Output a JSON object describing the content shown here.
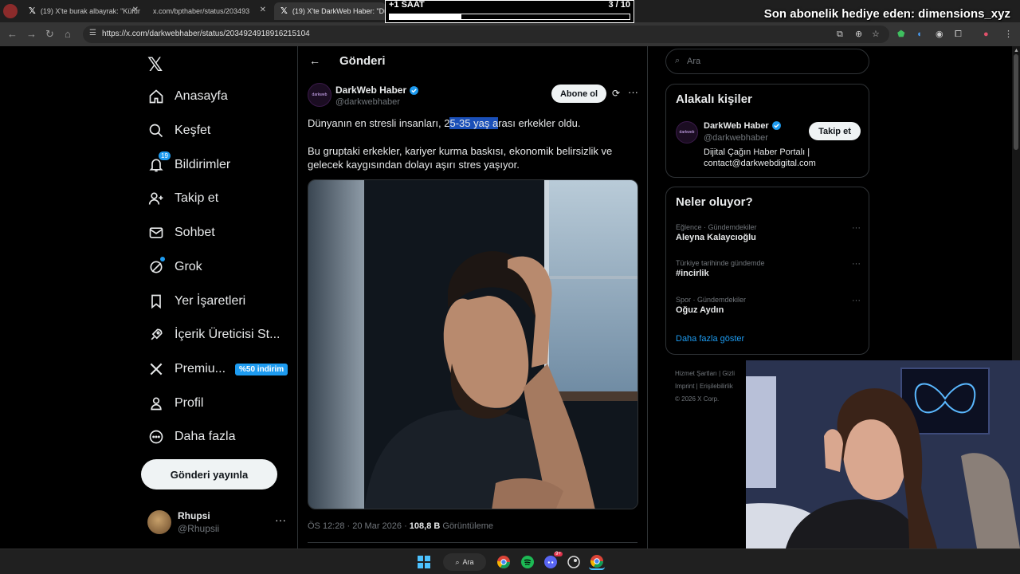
{
  "browser": {
    "tabs": [
      {
        "title": "(19) X'te burak albayrak: \"Küfür",
        "active": false
      },
      {
        "title": "x.com/bpthaber/status/203493",
        "active": false
      },
      {
        "title": "(19) X'te DarkWeb Haber: \"Dün",
        "active": true
      }
    ],
    "url": "https://x.com/darkwebhaber/status/2034924918916215104"
  },
  "overlay": {
    "timer_label": "+1 SAAT",
    "count": "3  / 10",
    "progress": 0.3,
    "sub_gift": "Son abonelik hediye eden: dimensions_xyz"
  },
  "nav": {
    "items": [
      {
        "label": "Anasayfa",
        "icon": "home-icon"
      },
      {
        "label": "Keşfet",
        "icon": "search-icon"
      },
      {
        "label": "Bildirimler",
        "icon": "bell-icon",
        "badge": "19"
      },
      {
        "label": "Takip et",
        "icon": "follow-icon"
      },
      {
        "label": "Sohbet",
        "icon": "mail-icon"
      },
      {
        "label": "Grok",
        "icon": "grok-icon"
      },
      {
        "label": "Yer İşaretleri",
        "icon": "bookmark-icon"
      },
      {
        "label": "İçerik Üreticisi St...",
        "icon": "rocket-icon"
      },
      {
        "label": "Premiu...",
        "icon": "x-premium-icon",
        "tag": "%50 indirim"
      },
      {
        "label": "Profil",
        "icon": "profile-icon"
      },
      {
        "label": "Daha fazla",
        "icon": "more-circle-icon"
      }
    ],
    "post_button": "Gönderi yayınla",
    "account": {
      "name": "Rhupsi",
      "handle": "@Rhupsii"
    }
  },
  "post": {
    "header_title": "Gönderi",
    "author_name": "DarkWeb Haber",
    "author_handle": "@darkwebhaber",
    "avatar_text": "darkweb",
    "subscribe_label": "Abone ol",
    "text1_before": "Dünyanın en stresli insanları, 2",
    "text1_highlight": "5-35 yaş a",
    "text1_after": "rası erkekler oldu.",
    "text2": "Bu gruptaki erkekler, kariyer kurma baskısı, ekonomik belirsizlik ve gelecek kaygısından dolayı aşırı stres yaşıyor.",
    "meta_time": "ÖS 12:28 · 20 Mar 2026 · ",
    "meta_views": "108,8 B",
    "meta_views_label": " Görüntüleme"
  },
  "right": {
    "search_placeholder": "Ara",
    "relevant": {
      "title": "Alakalı kişiler",
      "name": "DarkWeb Haber",
      "handle": "@darkwebhaber",
      "bio": "Dijital Çağın Haber Portalı | contact@darkwebdigital.com",
      "follow_label": "Takip et"
    },
    "trends": {
      "title": "Neler oluyor?",
      "items": [
        {
          "context": "Eğlence · Gündemdekiler",
          "name": "Aleyna Kalaycıoğlu"
        },
        {
          "context": "Türkiye tarihinde gündemde",
          "name": "#incirlik"
        },
        {
          "context": "Spor · Gündemdekiler",
          "name": "Oğuz Aydın"
        }
      ],
      "show_more": "Daha fazla göster"
    },
    "footer": [
      "Hizmet Şartları  |  Gizli",
      "Imprint  |  Erişilebilirlik",
      "© 2026 X Corp."
    ]
  },
  "taskbar": {
    "search_label": "Ara",
    "discord_badge": "9+"
  },
  "colors": {
    "accent": "#1d9bf0",
    "background": "#000000",
    "border": "#2f3336",
    "muted_text": "#71767b"
  }
}
